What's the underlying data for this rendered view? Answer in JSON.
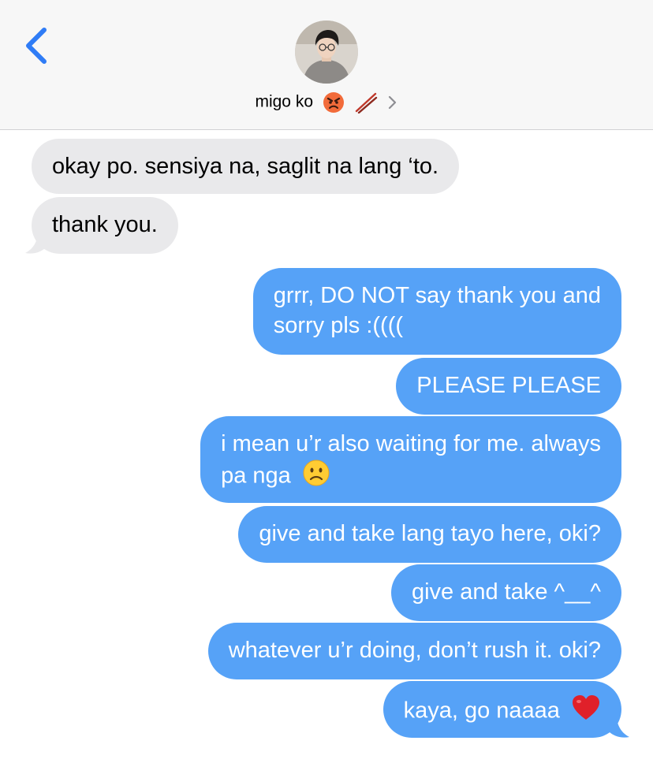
{
  "header": {
    "back_icon": "chevron-left-icon",
    "contact_name": "migo ko",
    "contact_emojis": [
      "angry-face-emoji",
      "chopsticks-emoji"
    ],
    "disclosure_icon": "chevron-right-icon"
  },
  "messages": [
    {
      "direction": "incoming",
      "text": "okay po. sensiya na, saglit na lang ‘to."
    },
    {
      "direction": "incoming",
      "text": "thank you."
    },
    {
      "direction": "outgoing",
      "line1": "grrr, DO NOT say thank you and",
      "line2": "sorry pls :(((("
    },
    {
      "direction": "outgoing",
      "text": "PLEASE PLEASE"
    },
    {
      "direction": "outgoing",
      "line1": "i mean u’r also waiting for me. always",
      "line2": "pa nga",
      "emoji": "confused-face-emoji"
    },
    {
      "direction": "outgoing",
      "text": "give and take lang tayo here, oki?"
    },
    {
      "direction": "outgoing",
      "text": "give and take ^__^"
    },
    {
      "direction": "outgoing",
      "text": "whatever u’r doing, don’t rush it. oki?"
    },
    {
      "direction": "outgoing",
      "text": "kaya, go naaaa",
      "emoji": "red-heart-emoji"
    }
  ],
  "colors": {
    "header_bg": "#f7f7f7",
    "incoming_bubble": "#e9e9eb",
    "outgoing_bubble": "#56a2f7",
    "accent_blue": "#2f7cf6"
  }
}
